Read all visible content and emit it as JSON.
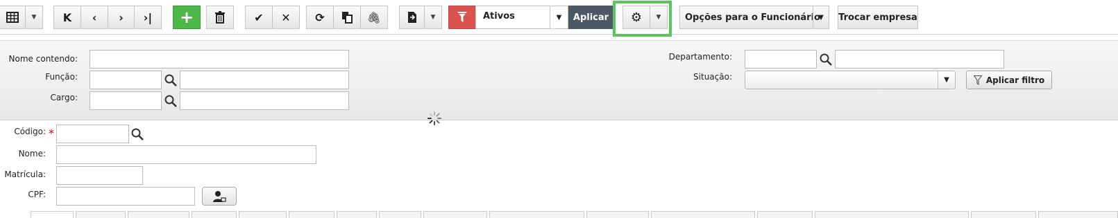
{
  "toolbar": {
    "filter_value": "Ativos",
    "apply_label": "Aplicar",
    "employee_options_label": "Opções para o Funcionário",
    "switch_company_label": "Trocar empresa"
  },
  "filters": {
    "name_label": "Nome contendo:",
    "function_label": "Função:",
    "position_label": "Cargo:",
    "department_label": "Departamento:",
    "status_label": "Situação:",
    "apply_filter_label": "Aplicar filtro"
  },
  "form": {
    "code_label": "Código:",
    "required_mark": "*",
    "name_label": "Nome:",
    "registration_label": "Matrícula:",
    "cpf_label": "CPF:"
  },
  "colors": {
    "add_green": "#4cb848",
    "filter_red": "#d9534f",
    "apply_dark": "#4d5866",
    "highlight_green": "#5cc45c"
  }
}
